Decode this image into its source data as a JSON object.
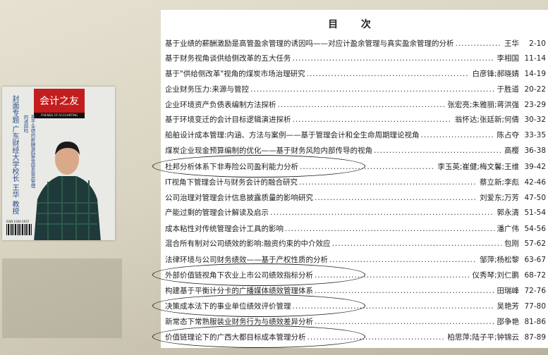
{
  "cover": {
    "journal_title": "会计之友",
    "journal_subtitle": "FRIENDS OF ACCOUNTING",
    "feature_label": "封面专题",
    "feature_subject": "广东财经大学校长 王华 教授",
    "feature_article": "基于业绩的薪酬激励是高管盈余管理的诱因吗",
    "isbn": "ISSN 1004-5937"
  },
  "toc": {
    "heading": "目 次",
    "entries": [
      {
        "title": "基于业绩的薪酬激励是高管盈余管理的诱因吗——对应计盈余管理与真实盈余管理的分析",
        "author": "王华",
        "pages": "2-10",
        "circled": false
      },
      {
        "title": "基于财务视角谈供给侧改革的五大任务",
        "author": "李相国",
        "pages": "11-14",
        "circled": false
      },
      {
        "title": "基于\"供给侧改革\"视角的煤炭市场治理研究",
        "author": "白彦锋;郝晓婧",
        "pages": "14-19",
        "circled": false
      },
      {
        "title": "企业财务压力:来源与管控",
        "author": "于胜道",
        "pages": "20-22",
        "circled": false
      },
      {
        "title": "企业环境资产负债表编制方法探析",
        "author": "张宏亮;朱雅丽;蒋洪强",
        "pages": "23-29",
        "circled": false
      },
      {
        "title": "基于环境变迁的会计目标逻辑演进探析",
        "author": "翁怀达;张廷新;何倩",
        "pages": "30-32",
        "circled": false
      },
      {
        "title": "船舶设计成本管理:内涵、方法与案例——基于管理会计和全生命周期理论视角",
        "author": "陈占夺",
        "pages": "33-35",
        "circled": false
      },
      {
        "title": "煤炭企业现金预算编制的优化——基于财务风险内部传导的视角",
        "author": "高樱",
        "pages": "36-38",
        "circled": false
      },
      {
        "title": "杜邦分析体系下非寿险公司盈利能力分析",
        "author": "李玉英;崔健;梅文馨;王维",
        "pages": "39-42",
        "circled": true
      },
      {
        "title": "IT视角下管理会计与财务会计的融合研究",
        "author": "蔡立新;李彪",
        "pages": "42-46",
        "circled": false
      },
      {
        "title": "公司治理对管理会计信息披露质量的影响研究",
        "author": "刘爱东;万芳",
        "pages": "47-50",
        "circled": false
      },
      {
        "title": "产能过剩的管理会计解读及启示",
        "author": "郭永清",
        "pages": "51-54",
        "circled": false
      },
      {
        "title": "成本粘性对传统管理会计工具的影响",
        "author": "潘广伟",
        "pages": "54-56",
        "circled": false
      },
      {
        "title": "混合所有制对公司绩效的影响:融资约束的中介效应",
        "author": "包刚",
        "pages": "57-62",
        "circled": false
      },
      {
        "title": "法律环境与公司财务绩效——基于产权性质的分析",
        "author": "邹萍;杨松黎",
        "pages": "63-67",
        "circled": false
      },
      {
        "title": "外部价值链视角下农业上市公司绩效指标分析",
        "author": "仪秀琴;刘仁鹏",
        "pages": "68-72",
        "circled": true
      },
      {
        "title": "构建基于平衡计分卡的广播媒体绩效管理体系",
        "author": "田瑞峰",
        "pages": "72-76",
        "circled": false
      },
      {
        "title": "决策成本法下的事业单位绩效评价管理",
        "author": "吴艳芳",
        "pages": "77-80",
        "circled": true
      },
      {
        "title": "新常态下常熟服装业财务行为与绩效差异分析",
        "author": "邵争艳",
        "pages": "81-86",
        "circled": false
      },
      {
        "title": "价值链理论下的广西大都目标成本管理分析",
        "author": "柏思萍;陆子平;钟锦云",
        "pages": "87-89",
        "circled": true
      }
    ]
  }
}
